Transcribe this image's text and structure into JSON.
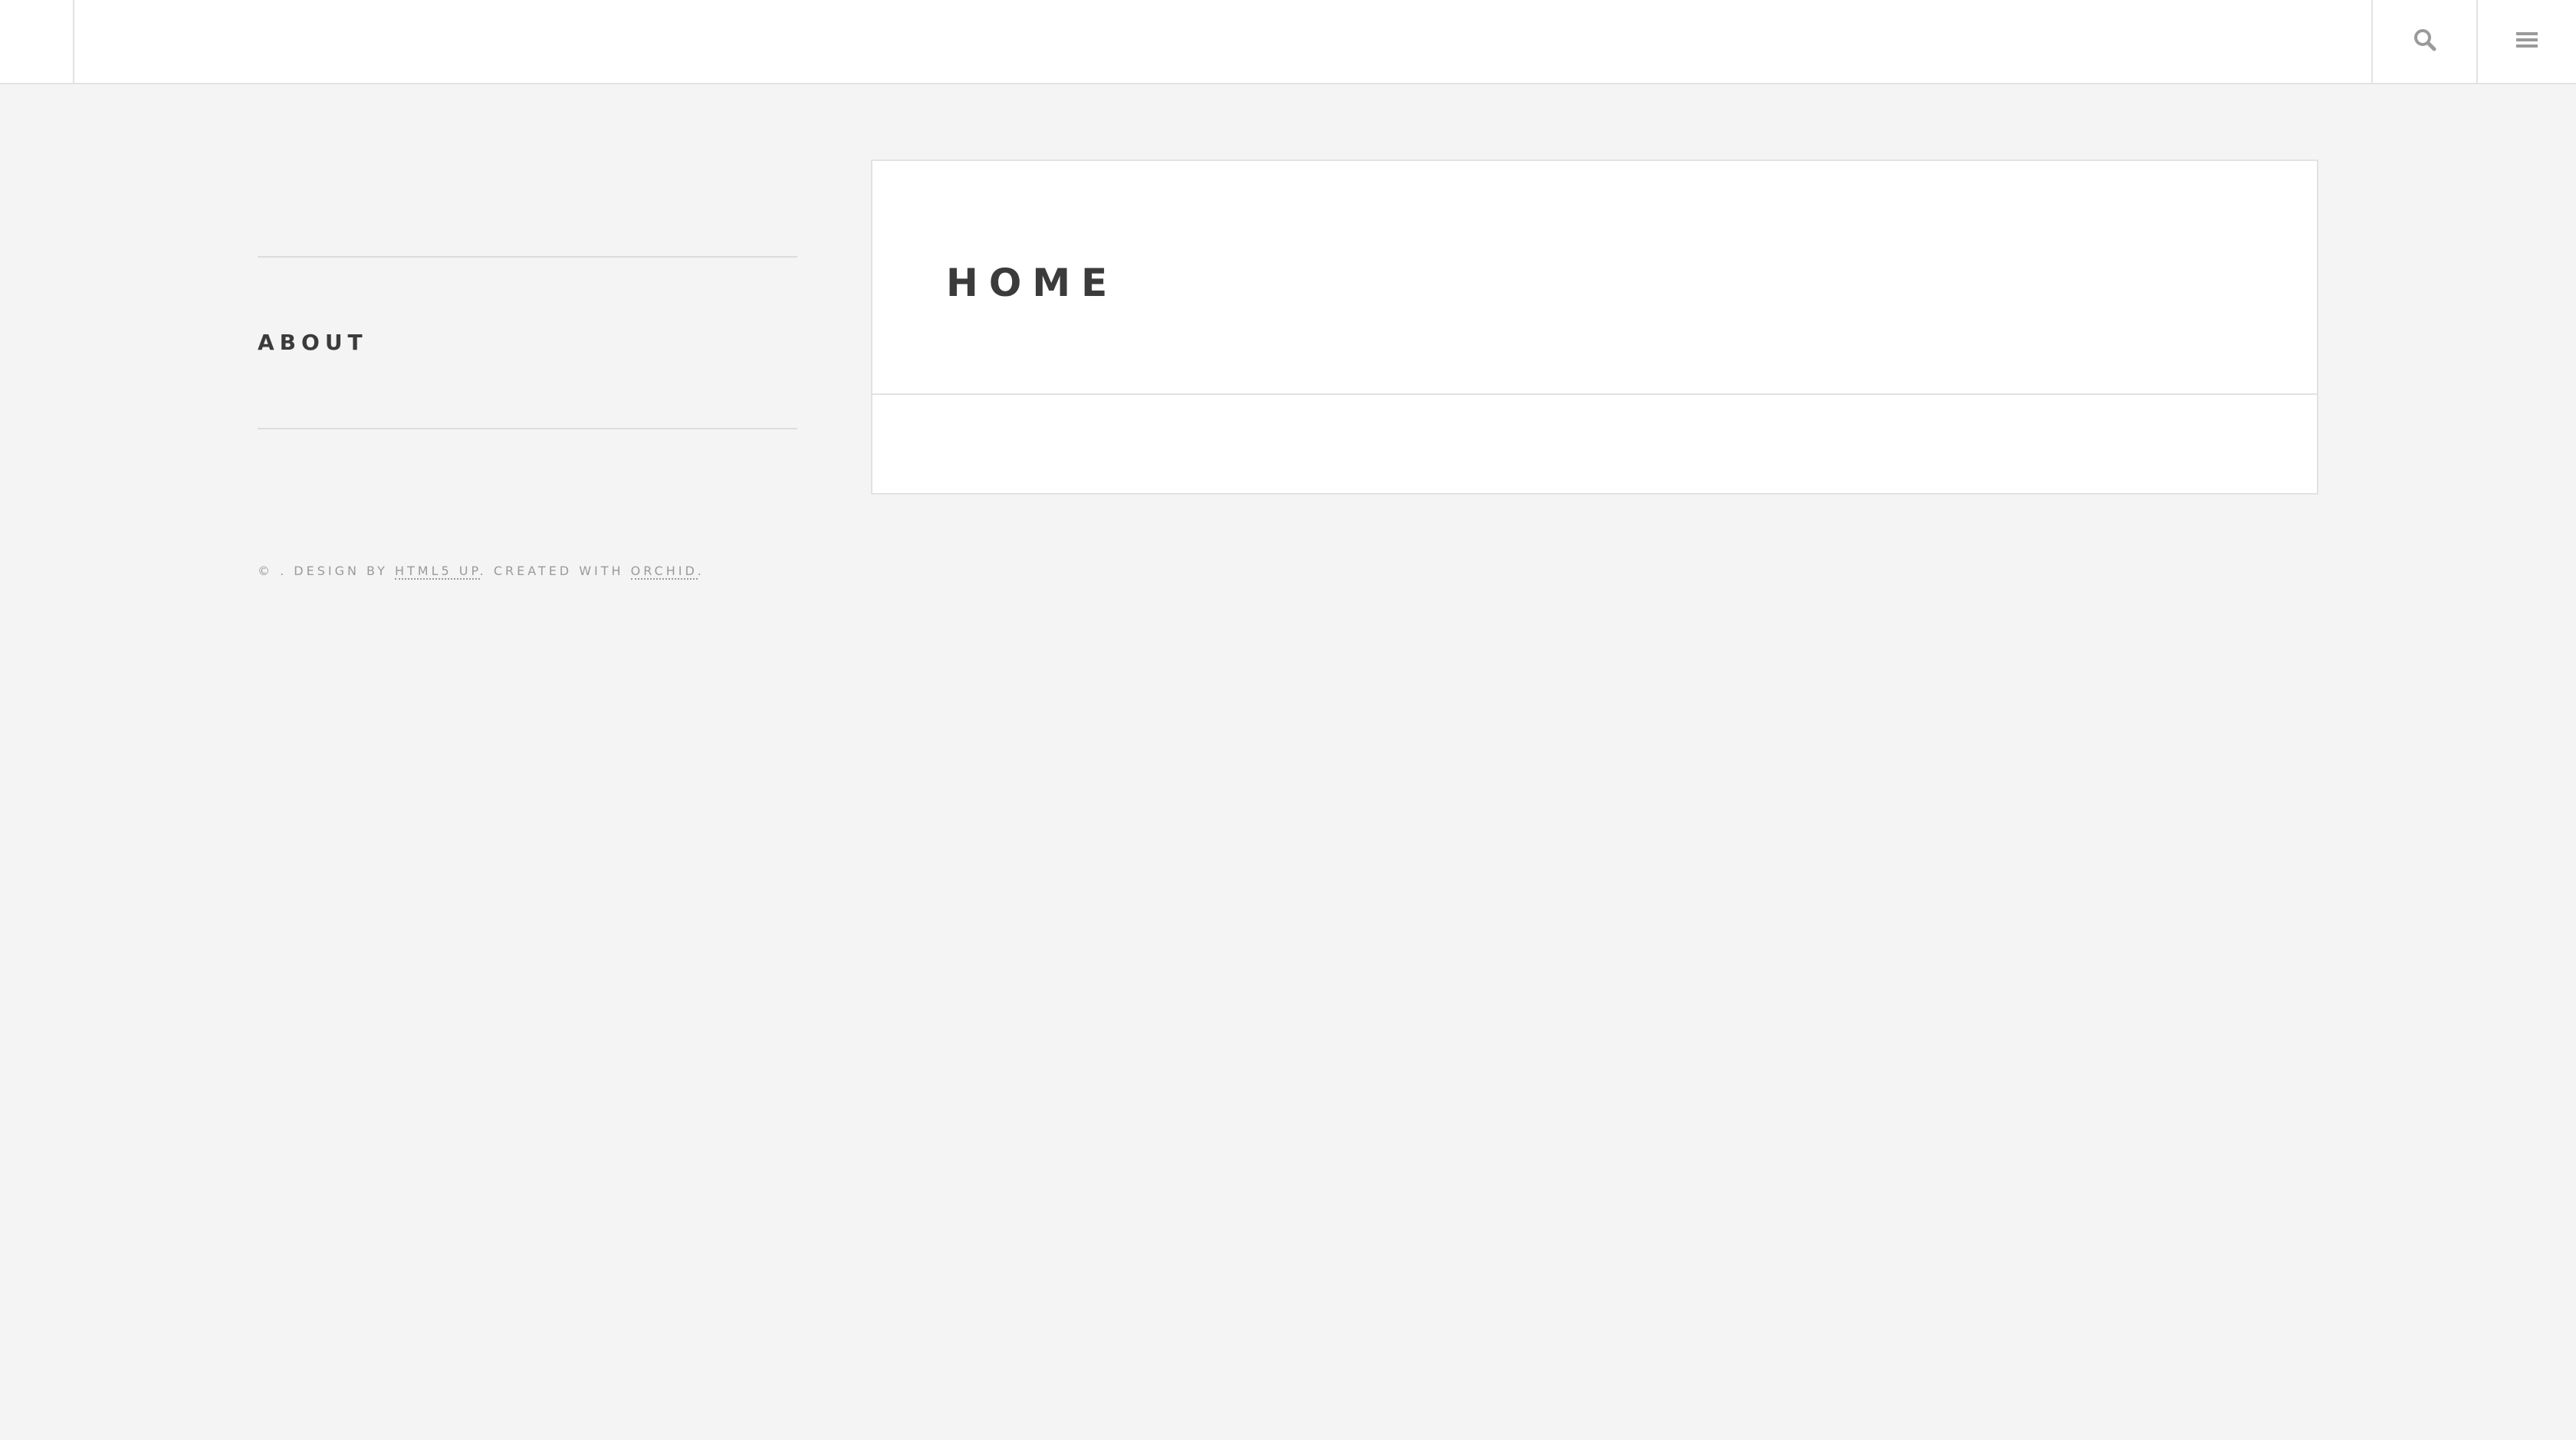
{
  "header": {
    "search_icon": "search-icon",
    "menu_icon": "menu-icon"
  },
  "sidebar": {
    "items": [
      {
        "label": "ABOUT"
      }
    ]
  },
  "footer": {
    "copyright_prefix": "© . DESIGN BY ",
    "design_link": "HTML5 UP",
    "middle": ". CREATED WITH ",
    "created_link": "ORCHID",
    "suffix": "."
  },
  "main": {
    "title": "HOME"
  },
  "colors": {
    "background": "#f4f4f4",
    "text": "#3c3b3b",
    "border": "#e2e2e2",
    "muted": "#9a9a9a"
  }
}
